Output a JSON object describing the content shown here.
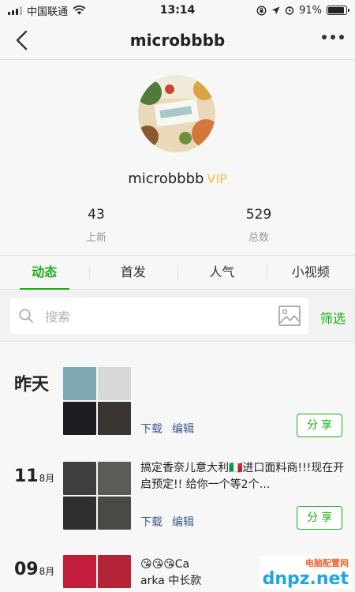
{
  "status_bar": {
    "carrier": "中国联通",
    "time": "13:14",
    "battery": "91%",
    "battery_level": 0.91
  },
  "header": {
    "title": "microbbbb"
  },
  "profile": {
    "name": "microbbbb",
    "vip_label": "VIP",
    "stats": [
      {
        "value": "43",
        "label": "上新"
      },
      {
        "value": "529",
        "label": "总数"
      }
    ]
  },
  "tabs": [
    {
      "label": "动态",
      "active": true
    },
    {
      "label": "首发",
      "active": false
    },
    {
      "label": "人气",
      "active": false
    },
    {
      "label": "小视频",
      "active": false
    }
  ],
  "search": {
    "placeholder": "搜索",
    "filter_label": "筛选"
  },
  "posts": [
    {
      "date_big": "昨天",
      "date_month": "",
      "text": "",
      "action_download": "下载",
      "action_edit": "编辑",
      "share_label": "分享",
      "thumb_colors": [
        "#7fa9b3",
        "#d8d8d8",
        "#1c1c22",
        "#3a3530"
      ]
    },
    {
      "date_big": "11",
      "date_month": "8月",
      "text": "搞定香奈儿意大利🇮🇹进口面料商!!!现在开启预定!! 给你一个等2个…",
      "action_download": "下载",
      "action_edit": "编辑",
      "share_label": "分享",
      "thumb_colors": [
        "#3d3f3c",
        "#5c5b55",
        "#2f302e",
        "#4a4944"
      ]
    },
    {
      "date_big": "09",
      "date_month": "8月",
      "text": "😘😘😘Ca arka 中长款",
      "thumb_colors": [
        "#c21d3a",
        "#b52336"
      ]
    }
  ],
  "watermark": {
    "text": "dnpz.net",
    "subtext": "电脑配置网"
  },
  "icons": {
    "back": "chevron-left-icon",
    "more": "more-icon",
    "search": "search-icon",
    "image": "image-icon"
  },
  "colors": {
    "accent": "#1aad19",
    "vip": "#f0c53e",
    "link": "#3b5a8c"
  }
}
